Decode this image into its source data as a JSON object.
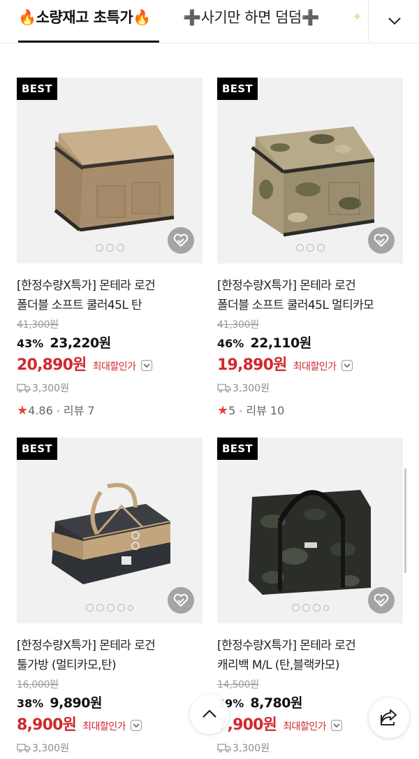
{
  "tabs": [
    {
      "label": "🔥소량재고 초특가🔥",
      "active": true
    },
    {
      "label": "➕사기만 하면 덤덤➕",
      "active": false
    }
  ],
  "colors": {
    "accent_red": "#d0282e",
    "star": "#e2463c"
  },
  "products": [
    {
      "badge": "BEST",
      "title_line1": "[한정수량X특가] 몬테라 로건",
      "title_line2": "폴더블 소프트 쿨러45L 탄",
      "original_price": "41,300원",
      "discount_rate": "43%",
      "discount_price": "23,220원",
      "final_price": "20,890원",
      "max_discount_label": "최대할인가",
      "shipping": "3,300원",
      "rating": "4.86",
      "review_label": "리뷰 7",
      "image_dots": 3,
      "product_icon": "tan-cooler-bag"
    },
    {
      "badge": "BEST",
      "title_line1": "[한정수량X특가] 몬테라 로건",
      "title_line2": "폴더블 소프트 쿨러45L 멀티카모",
      "original_price": "41,300원",
      "discount_rate": "46%",
      "discount_price": "22,110원",
      "final_price": "19,890원",
      "max_discount_label": "최대할인가",
      "shipping": "3,300원",
      "rating": "5",
      "review_label": "리뷰 10",
      "image_dots": 3,
      "product_icon": "camo-cooler-bag"
    },
    {
      "badge": "BEST",
      "title_line1": "[한정수량X특가] 몬테라 로건",
      "title_line2": "툴가방 (멀티카모,탄)",
      "original_price": "16,000원",
      "discount_rate": "38%",
      "discount_price": "9,890원",
      "final_price": "8,900원",
      "max_discount_label": "최대할인가",
      "shipping": "3,300원",
      "image_dots": 5,
      "product_icon": "tool-bag"
    },
    {
      "badge": "BEST",
      "title_line1": "[한정수량X특가] 몬테라 로건",
      "title_line2": "캐리백 M/L (탄,블랙카모)",
      "original_price": "14,500원",
      "discount_rate": "39%",
      "discount_price": "8,780원",
      "final_price": "7,900원",
      "max_discount_label": "최대할인가",
      "shipping": "3,300원",
      "image_dots": 4,
      "product_icon": "black-camo-carry-bag"
    }
  ]
}
